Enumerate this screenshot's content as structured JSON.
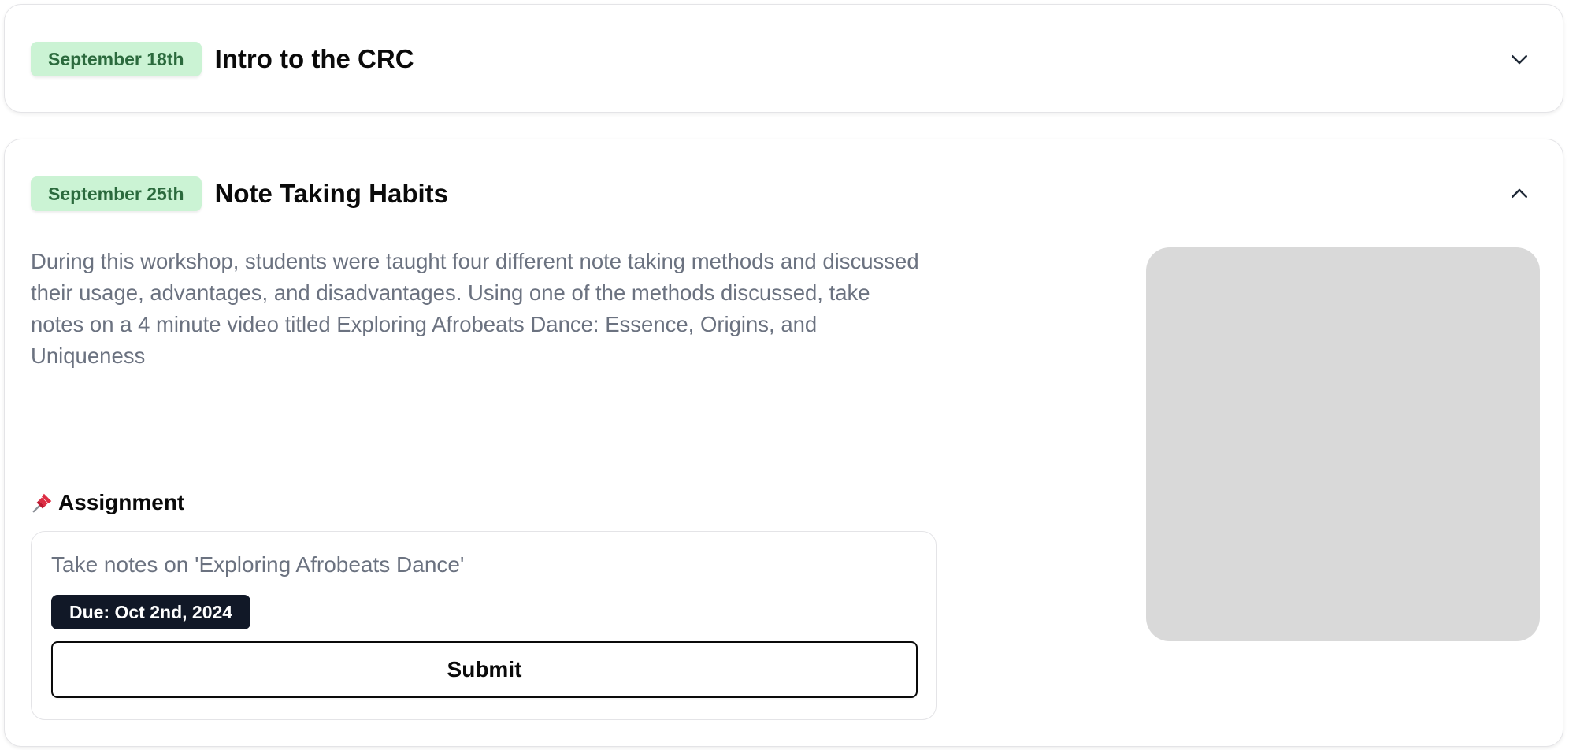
{
  "sessions": [
    {
      "date": "September 18th",
      "title": "Intro to the CRC",
      "expanded": false,
      "chevron_icon": "chevron-down-icon"
    },
    {
      "date": "September 25th",
      "title": "Note Taking Habits",
      "expanded": true,
      "chevron_icon": "chevron-up-icon",
      "description": "During this workshop, students were taught four different note taking methods and discussed their usage, advantages, and disadvantages. Using one of the methods discussed, take notes on a 4 minute video titled Exploring Afrobeats Dance: Essence, Origins, and Uniqueness",
      "assignment_heading": "Assignment",
      "assignment_icon": "pushpin-icon",
      "assignment": {
        "name": "Take notes on 'Exploring Afrobeats Dance'",
        "due": "Due: Oct 2nd, 2024",
        "submit_label": "Submit"
      }
    }
  ],
  "colors": {
    "date_badge_bg": "#cbf3d4",
    "date_badge_text": "#2b6a3d",
    "due_badge_bg": "#111827",
    "muted_text": "#6b7280",
    "placeholder_bg": "#d9d9d9",
    "pin_red": "#dd2e44"
  }
}
